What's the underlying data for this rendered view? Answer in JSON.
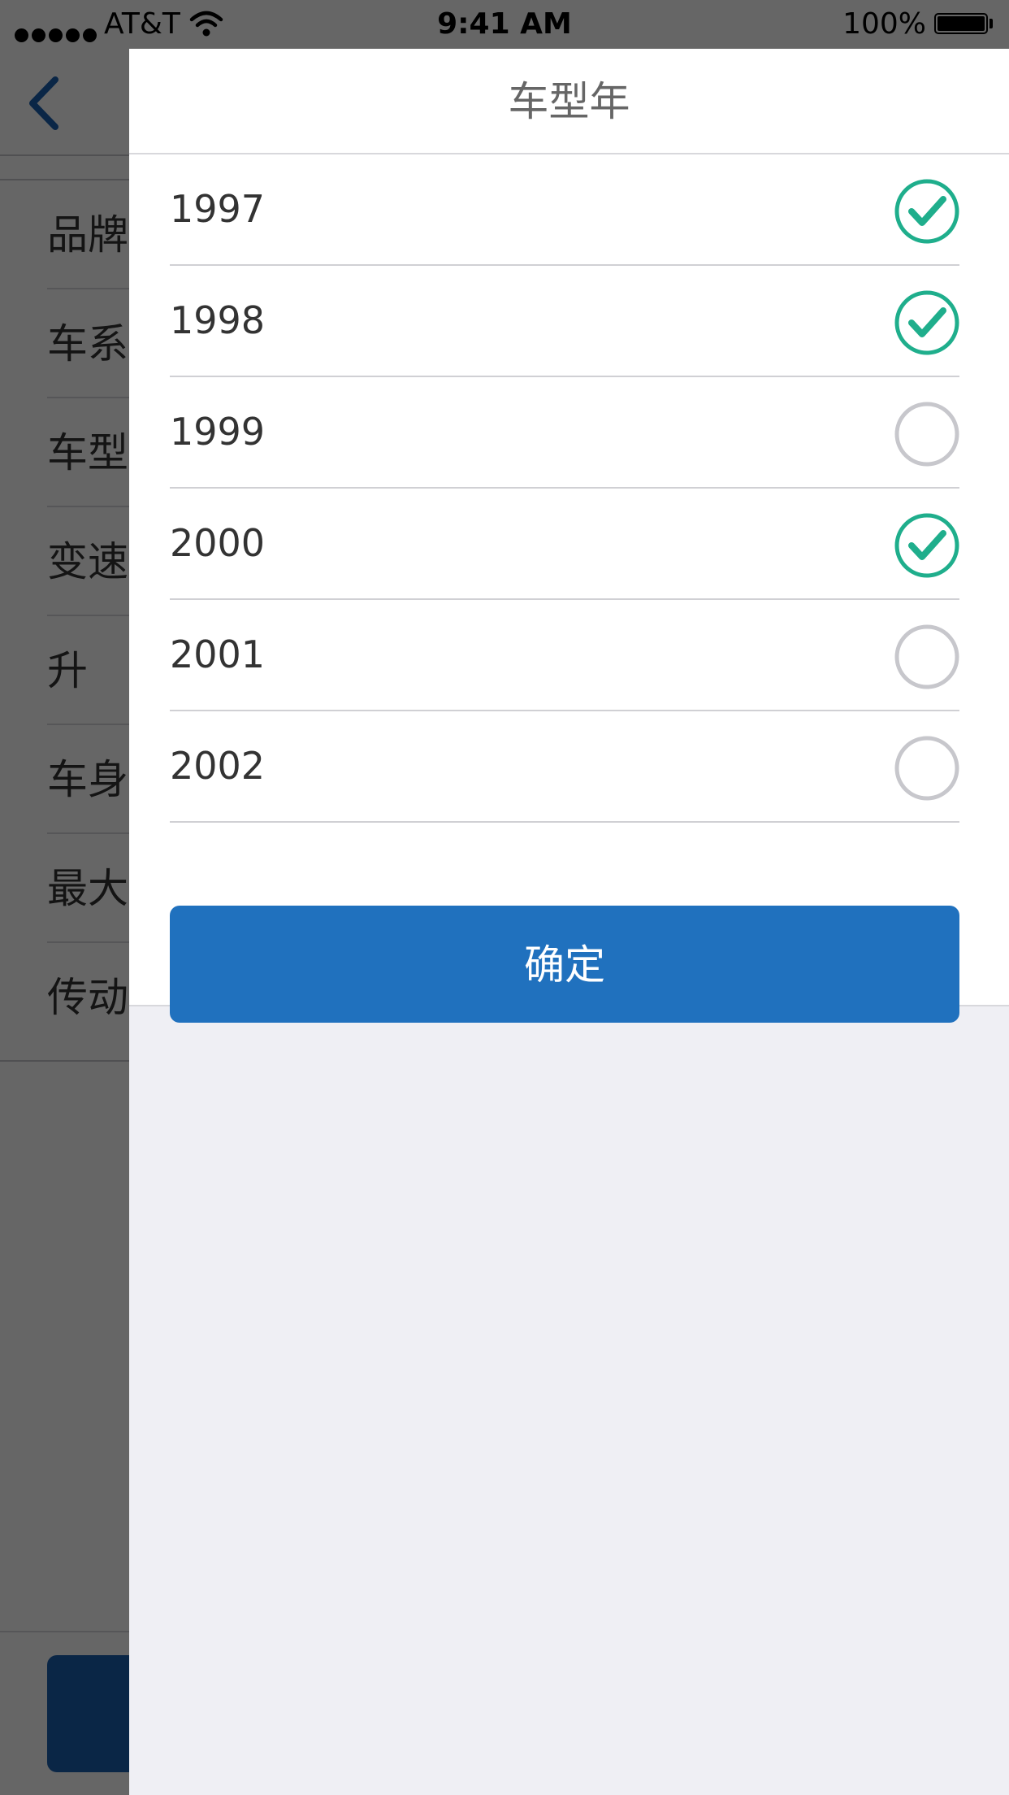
{
  "status_bar": {
    "carrier": "AT&T",
    "time": "9:41 AM",
    "battery": "100%"
  },
  "background_page": {
    "back_icon": "chevron-left-icon",
    "rows": [
      "品牌",
      "车系",
      "车型",
      "变速",
      "升",
      "车身",
      "最大",
      "传动"
    ]
  },
  "drawer": {
    "title": "车型年",
    "options": [
      {
        "year": "1997",
        "selected": true
      },
      {
        "year": "1998",
        "selected": true
      },
      {
        "year": "1999",
        "selected": false
      },
      {
        "year": "2000",
        "selected": true
      },
      {
        "year": "2001",
        "selected": false
      },
      {
        "year": "2002",
        "selected": false
      }
    ],
    "confirm_label": "确定",
    "colors": {
      "check_selected": "#1fae8c",
      "check_unselected": "#c7c7cc",
      "confirm_button": "#2071be"
    }
  }
}
